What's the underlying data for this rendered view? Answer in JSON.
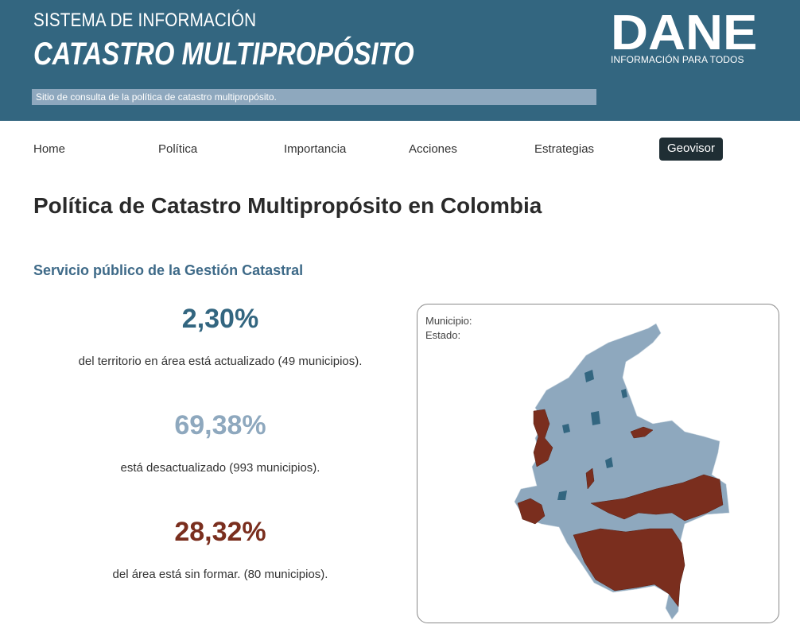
{
  "header": {
    "system_label": "SISTEMA DE INFORMACIÓN",
    "title": "CATASTRO MULTIPROPÓSITO",
    "subtitle": "Sitio de consulta de la política de catastro multipropósito.",
    "logo_word": "DANE",
    "logo_tagline": "INFORMACIÓN PARA TODOS"
  },
  "nav": {
    "items": [
      {
        "label": "Home"
      },
      {
        "label": "Política"
      },
      {
        "label": "Importancia"
      },
      {
        "label": "Acciones"
      },
      {
        "label": "Estrategias"
      }
    ],
    "active_label": "Geovisor"
  },
  "main": {
    "page_title": "Política de Catastro Multipropósito en Colombia",
    "section_title": "Servicio público de la Gestión Catastral",
    "stats": [
      {
        "value": "2,30%",
        "description": "del territorio en área está actualizado (49 municipios).",
        "color": "#336680"
      },
      {
        "value": "69,38%",
        "description": "está desactualizado (993 municipios).",
        "color": "#8ea8be"
      },
      {
        "value": "28,32%",
        "description": "del área está sin formar. (80 municipios).",
        "color": "#7a2e1e"
      }
    ]
  },
  "map": {
    "municipio_label": "Municipio:",
    "estado_label": "Estado:",
    "colors": {
      "updated": "#336680",
      "outdated": "#8ea8be",
      "unformed": "#7a2e1e"
    }
  }
}
